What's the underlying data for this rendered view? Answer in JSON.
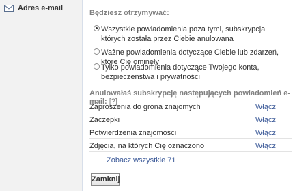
{
  "sidebar": {
    "title": "Adres e-mail",
    "icon": "envelope-icon"
  },
  "receive": {
    "title": "Będziesz otrzymywać:",
    "options": [
      {
        "label": "Wszystkie powiadomienia poza tymi, subskrypcja których została przez Ciebie anulowana",
        "checked": true
      },
      {
        "label": "Ważne powiadomienia dotyczące Ciebie lub zdarzeń, które Cię ominęły",
        "checked": false
      },
      {
        "label": "Tylko powiadomienia dotyczące Twojego konta, bezpieczeństwa i prywatności",
        "checked": false
      }
    ]
  },
  "unsubscribed": {
    "header": "Anulowałaś subskrypcję następujących powiadomień e-mail:",
    "help": "[?]",
    "rows": [
      {
        "name": "Zaproszenia do grona znajomych",
        "action": "Włącz"
      },
      {
        "name": "Zaczepki",
        "action": "Włącz"
      },
      {
        "name": "Potwierdzenia znajomości",
        "action": "Włącz"
      },
      {
        "name": "Zdjęcia, na których Cię oznaczono",
        "action": "Włącz"
      }
    ],
    "see_all": "Zobacz wszystkie 71"
  },
  "close_button": "Zamknij",
  "colors": {
    "link": "#3b5998",
    "sidebar_bg": "#f2f2f2",
    "muted": "#808080"
  }
}
